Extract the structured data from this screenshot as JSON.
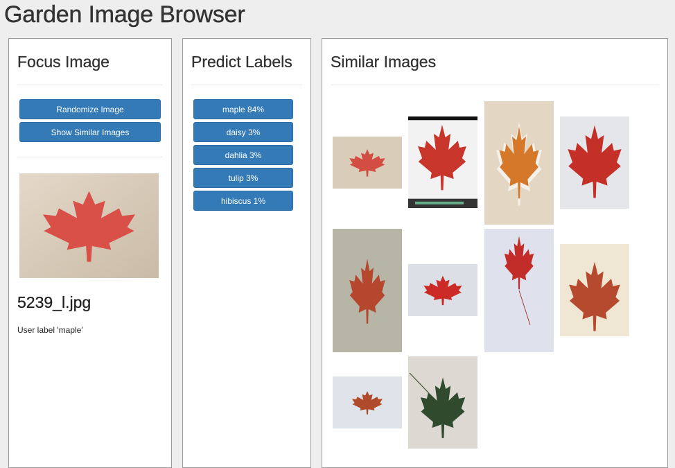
{
  "app": {
    "title": "Garden Image Browser"
  },
  "focus": {
    "heading": "Focus Image",
    "randomize_label": "Randomize Image",
    "show_similar_label": "Show Similar Images",
    "filename": "5239_l.jpg",
    "user_label": "User label 'maple'"
  },
  "predict": {
    "heading": "Predict Labels",
    "labels": [
      "maple 84%",
      "daisy 3%",
      "dahlia 3%",
      "tulip 3%",
      "hibiscus 1%"
    ]
  },
  "similar": {
    "heading": "Similar Images",
    "images": [
      "maple-leaf-image",
      "maple-leaf-image",
      "maple-leaf-image",
      "maple-leaf-image",
      "maple-leaf-image",
      "maple-leaf-image",
      "maple-leaf-image",
      "maple-leaf-image",
      "maple-leaf-image",
      "green-leaf-image"
    ]
  },
  "colors": {
    "primary_button": "#337ab7",
    "panel_border": "#9a9a9a",
    "page_bg": "#eeeeee"
  }
}
